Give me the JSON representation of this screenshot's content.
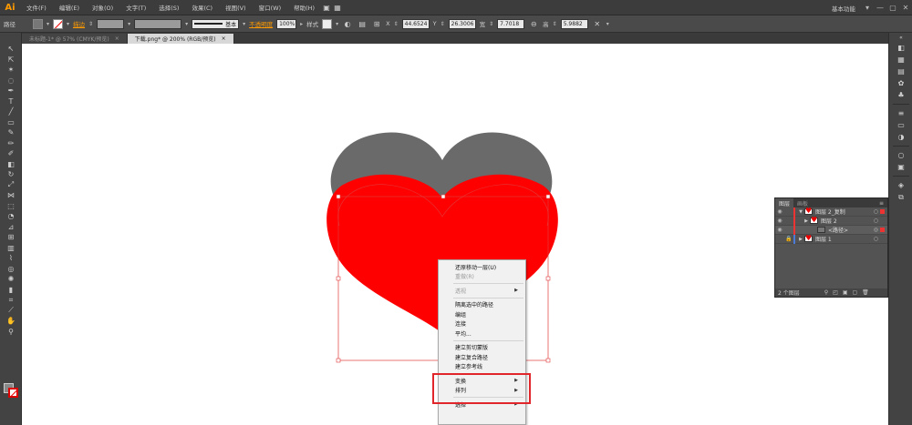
{
  "app": {
    "logo": "Ai"
  },
  "menubar": {
    "items": [
      "文件(F)",
      "编辑(E)",
      "对象(O)",
      "文字(T)",
      "选择(S)",
      "效果(C)",
      "视图(V)",
      "窗口(W)",
      "帮助(H)"
    ],
    "workspace": "基本功能",
    "window_buttons": [
      "▾",
      "—",
      "▢",
      "✕"
    ]
  },
  "controlbar": {
    "selection_label": "路径",
    "stroke_label": "描边",
    "stroke_style_label": "基本",
    "opacity_label": "不透明度",
    "opacity_value": "100%",
    "style_label": "样式",
    "x_label": "X",
    "x_value": "44.6524",
    "y_label": "Y",
    "y_value": "26.3006",
    "w_label": "宽",
    "w_value": "7.7018",
    "h_label": "高",
    "h_value": "5.9882"
  },
  "tabs": [
    {
      "label": "未标题-1* @ 57% (CMYK/预览)",
      "close": "×"
    },
    {
      "label": "下载.png* @ 200% (RGB/预览)",
      "close": "×"
    }
  ],
  "layers_panel": {
    "tabs": [
      "图层",
      "画板"
    ],
    "menu": "≡",
    "rows": [
      {
        "name": "图层 2_复制",
        "tri": "▼"
      },
      {
        "name": "图层 2",
        "tri": "▶"
      },
      {
        "name": "<路径>",
        "tri": ""
      },
      {
        "name": "图层 1",
        "tri": "▶"
      }
    ],
    "footer": "2 个图层"
  },
  "context_menu": {
    "items": [
      {
        "label": "还原移动一层(U)",
        "enabled": true
      },
      {
        "label": "重做(R)",
        "enabled": false
      },
      {
        "label": "透视",
        "enabled": false,
        "submenu": true
      },
      {
        "label": "隔离选中的路径",
        "enabled": true
      },
      {
        "label": "编组",
        "enabled": true
      },
      {
        "label": "连接",
        "enabled": true
      },
      {
        "label": "平均...",
        "enabled": true
      },
      {
        "label": "建立剪切蒙版",
        "enabled": true
      },
      {
        "label": "建立复合路径",
        "enabled": true
      },
      {
        "label": "建立参考线",
        "enabled": true
      },
      {
        "label": "变换",
        "enabled": true,
        "submenu": true
      },
      {
        "label": "排列",
        "enabled": true,
        "submenu": true
      },
      {
        "label": "选择",
        "enabled": true,
        "submenu": true
      }
    ]
  },
  "colors": {
    "heart_fill": "#ff0000",
    "heart_shadow": "#6a6a6a",
    "selection": "#e03a3a",
    "highlight_box": "#e0262a",
    "accent": "#ff9a00"
  }
}
